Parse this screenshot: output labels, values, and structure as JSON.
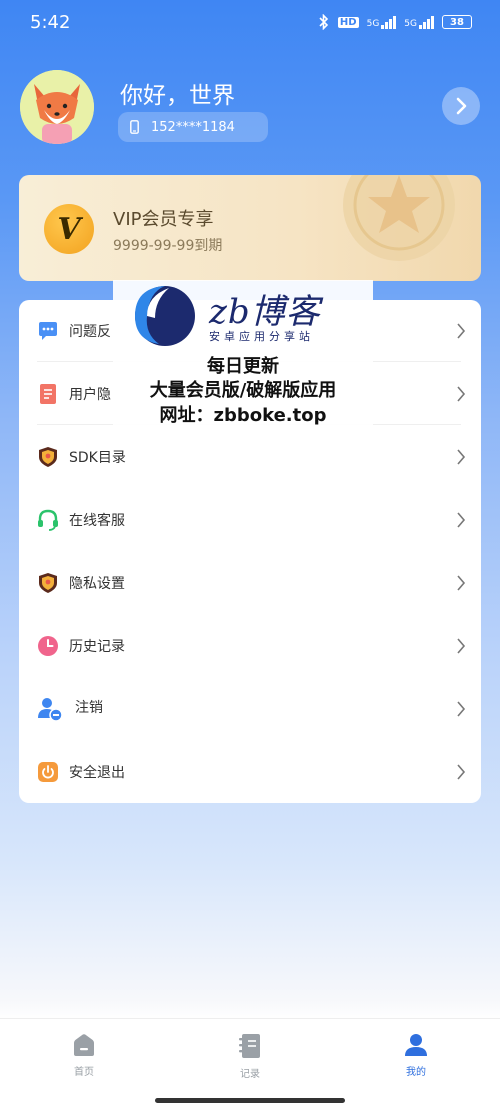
{
  "status_bar": {
    "time": "5:42",
    "hd": "HD",
    "net1": "5G",
    "net2": "5G",
    "battery": "38"
  },
  "profile": {
    "greeting": "你好，世界",
    "phone": "152****1184",
    "avatar_icon": "fox-avatar-icon"
  },
  "vip": {
    "badge": "V",
    "title": "VIP会员专享",
    "expire": "9999-99-99到期"
  },
  "menu": {
    "items": [
      {
        "label": "问题反",
        "icon": "chat-dots-icon",
        "color": "#4a90f5"
      },
      {
        "label": "用户隐",
        "icon": "document-icon",
        "color": "#f27466"
      },
      {
        "label": "SDK目录",
        "icon": "shield-icon",
        "color": "#e8574a"
      },
      {
        "label": "在线客服",
        "icon": "headset-icon",
        "color": "#2bc36b"
      },
      {
        "label": "隐私设置",
        "icon": "shield-icon",
        "color": "#e8574a"
      },
      {
        "label": "历史记录",
        "icon": "clock-icon",
        "color": "#f0648c"
      },
      {
        "label": "注销",
        "icon": "user-remove-icon",
        "color": "#3e86f0"
      },
      {
        "label": "安全退出",
        "icon": "power-icon",
        "color": "#f59a3c"
      }
    ]
  },
  "watermark": {
    "brand": "zb博客",
    "tagline": "安卓应用分享站",
    "line1": "每日更新",
    "line2": "大量会员版/破解版应用",
    "line3": "网址：zbboke.top"
  },
  "tabs": [
    {
      "label": "首页",
      "icon": "home-icon",
      "active": false
    },
    {
      "label": "记录",
      "icon": "notebook-icon",
      "active": false
    },
    {
      "label": "我的",
      "icon": "user-icon",
      "active": true
    }
  ],
  "colors": {
    "accent": "#2f6fde",
    "header_blue": "#3f86f3",
    "vip_gold": "#f2a21f"
  }
}
